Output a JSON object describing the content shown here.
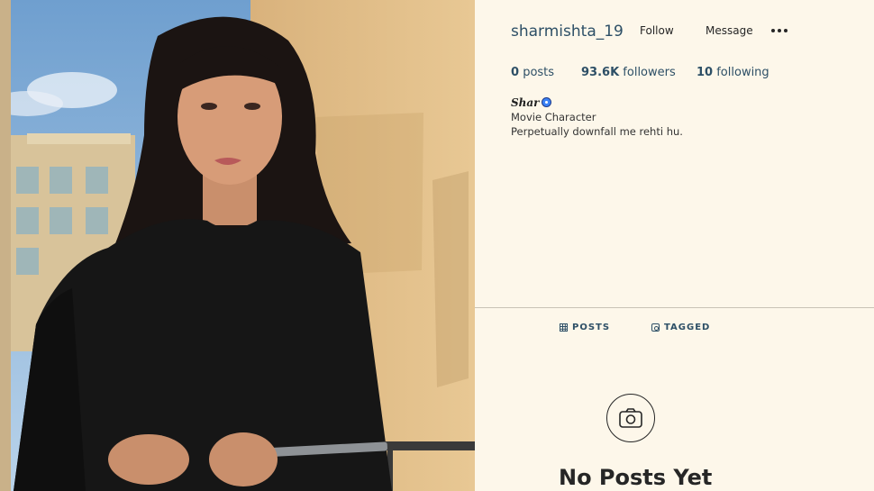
{
  "profile": {
    "username": "sharmishta_19",
    "follow_label": "Follow",
    "message_label": "Message",
    "more_icon": "more-options-icon",
    "stats": {
      "posts_count": "0",
      "posts_label": "posts",
      "followers_count": "93.6K",
      "followers_label": "followers",
      "following_count": "10",
      "following_label": "following"
    },
    "bio": {
      "name": "Shar",
      "verified_icon": "verified-badge-icon",
      "line1": "Movie Character",
      "line2": "Perpetually downfall me rehti hu."
    }
  },
  "tabs": [
    {
      "label": "POSTS",
      "icon": "grid-icon"
    },
    {
      "label": "TAGGED",
      "icon": "tag-icon"
    }
  ],
  "empty_state": {
    "icon": "camera-icon",
    "title": "No Posts Yet"
  },
  "colors": {
    "panel_background": "#fdf7ea",
    "link_text": "#2d4f66",
    "primary_text": "#262626"
  }
}
